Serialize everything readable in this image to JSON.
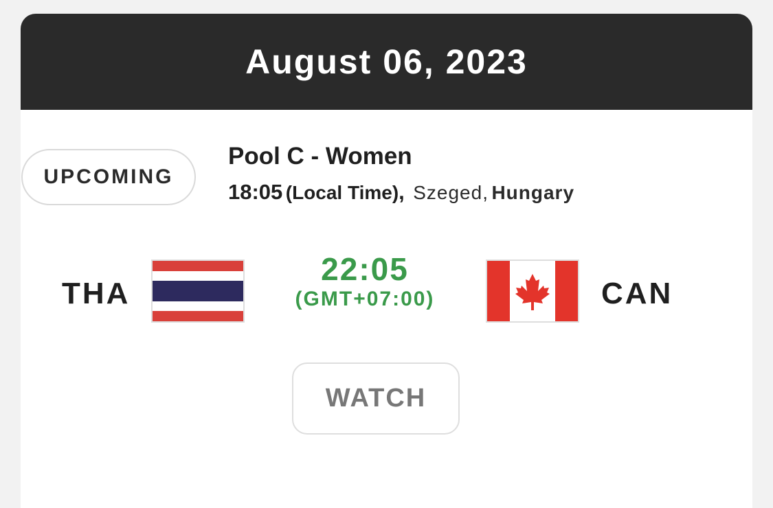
{
  "header": {
    "date": "August 06, 2023"
  },
  "match": {
    "status": "UPCOMING",
    "pool": "Pool C - Women",
    "local_time": "18:05",
    "local_time_label": "(Local Time)",
    "separator": ",",
    "city": "Szeged",
    "city_separator": ",",
    "country": "Hungary",
    "home_team": "THA",
    "away_team": "CAN",
    "converted_time": "22:05",
    "timezone": "(GMT+07:00)",
    "watch_label": "WATCH"
  },
  "flags": {
    "home": "thailand-flag-icon",
    "away": "canada-flag-icon"
  },
  "colors": {
    "header_bg": "#2a2a2a",
    "time_green": "#3a9a4a",
    "thai_red": "#d9403a",
    "thai_blue": "#2d2a5e",
    "canada_red": "#e3342b"
  }
}
